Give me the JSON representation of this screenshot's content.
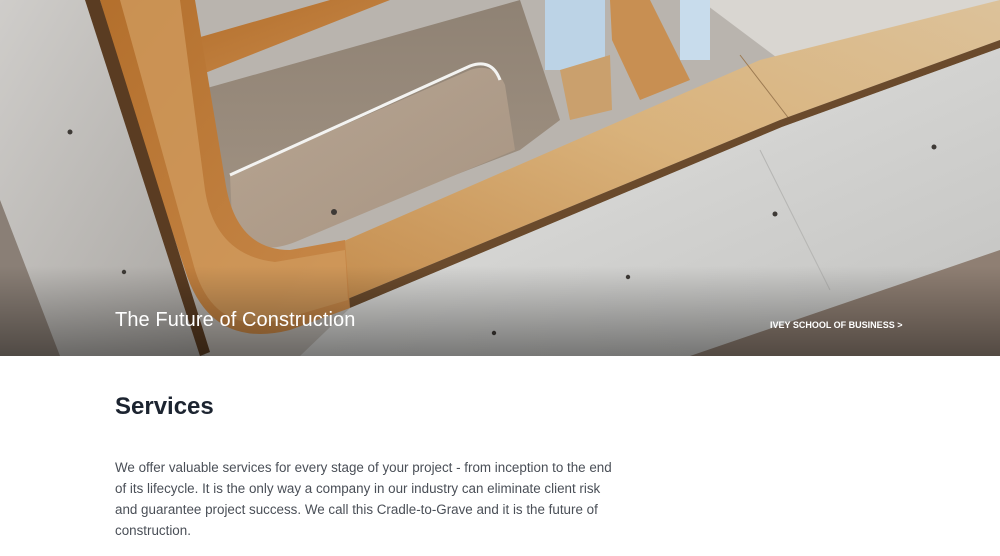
{
  "hero": {
    "title": "The Future of Construction",
    "link_label": "IVEY SCHOOL OF BUSINESS >",
    "image_desc": "architectural-interior-photo"
  },
  "services": {
    "heading": "Services",
    "body": "We offer valuable services for every stage of your project - from inception to the end of its lifecycle. It is the only way a company in our industry can eliminate client risk and guarantee project success. We call this Cradle-to-Grave and it is the future of construction."
  },
  "colors": {
    "heading": "#1c2430",
    "body_text": "#4a4f57",
    "wood": "#c99a5b",
    "concrete": "#d3d2cf"
  }
}
